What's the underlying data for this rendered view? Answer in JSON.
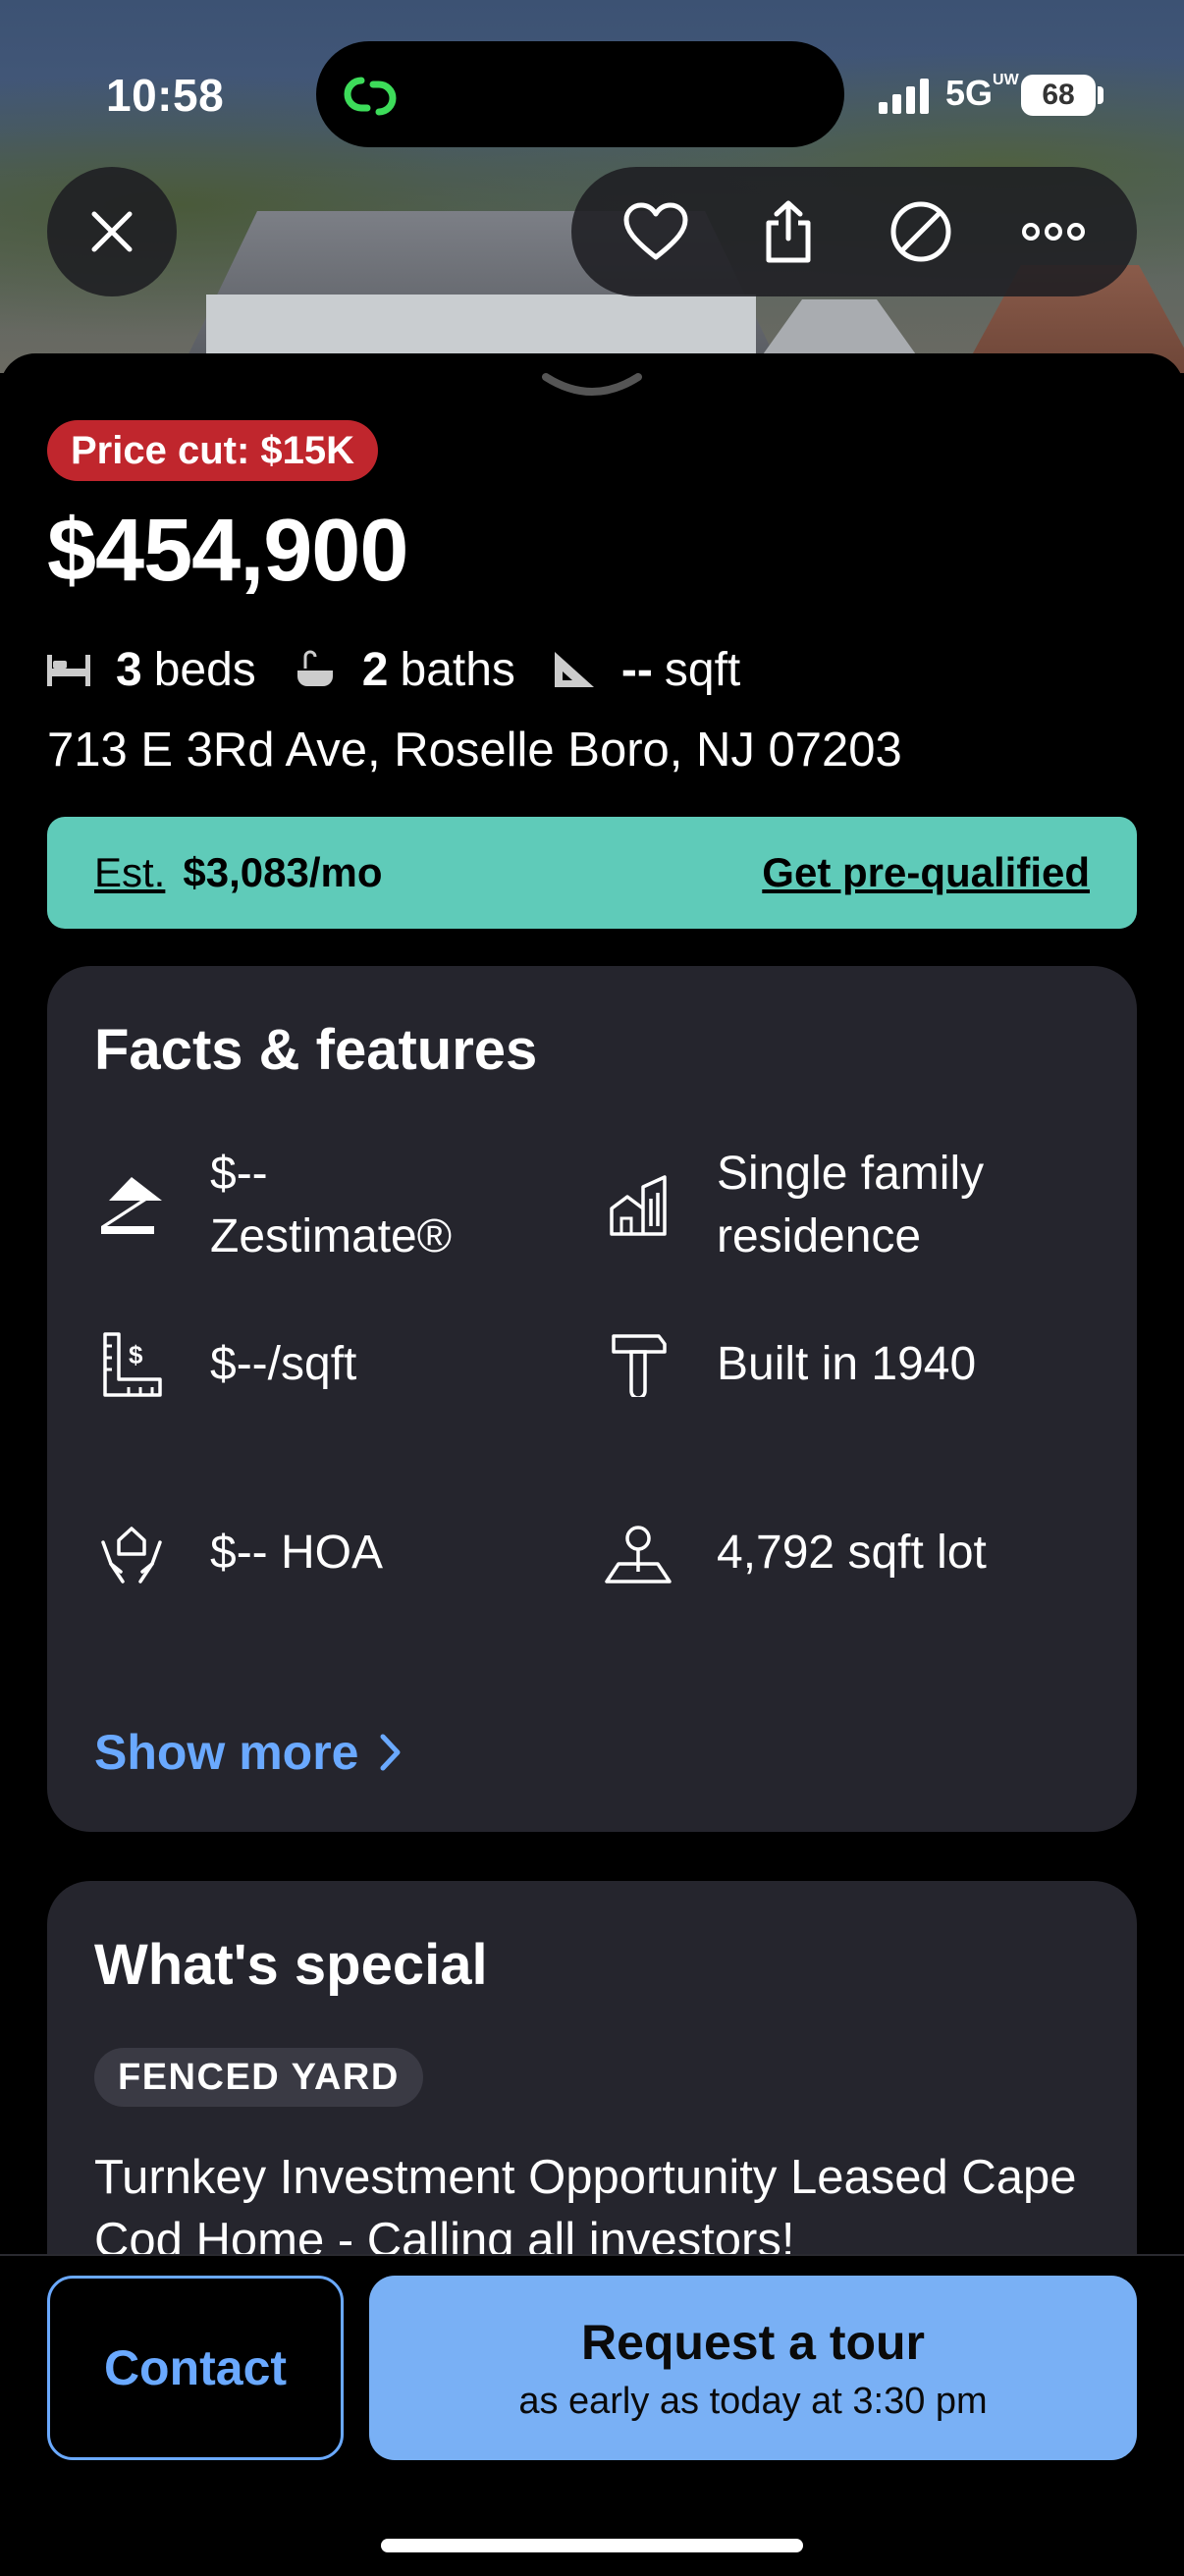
{
  "status_bar": {
    "time": "10:58",
    "network": "5G",
    "network_superscript": "UW",
    "battery": "68"
  },
  "header_actions": {
    "close_icon": "close-icon",
    "icons": [
      "heart-icon",
      "share-icon",
      "hide-icon",
      "more-icon"
    ]
  },
  "listing": {
    "badge": "Price cut: $15K",
    "price": "$454,900",
    "beds_num": "3",
    "beds_label": "beds",
    "baths_num": "2",
    "baths_label": "baths",
    "sqft_num": "--",
    "sqft_label": "sqft",
    "address": "713 E 3Rd Ave, Roselle Boro, NJ 07203"
  },
  "estimate": {
    "label": "Est.",
    "value": "$3,083/mo",
    "cta": "Get pre-qualified",
    "color": "#5fcbb9"
  },
  "facts": {
    "title": "Facts & features",
    "items": [
      {
        "icon": "zillow-icon",
        "text": "$--\nZestimate®"
      },
      {
        "icon": "building-icon",
        "text": "Single family\nresidence"
      },
      {
        "icon": "ruler-dollar-icon",
        "text": "$--/sqft"
      },
      {
        "icon": "hammer-icon",
        "text": "Built in 1940"
      },
      {
        "icon": "hoa-hands-icon",
        "text": "$-- HOA"
      },
      {
        "icon": "lot-icon",
        "text": "4,792 sqft lot"
      }
    ],
    "show_more": "Show more"
  },
  "special": {
    "title": "What's special",
    "tag": "FENCED YARD",
    "description": "Turnkey Investment Opportunity Leased Cape Cod Home - Calling all investors!"
  },
  "bottom": {
    "contact": "Contact",
    "tour_title": "Request a tour",
    "tour_sub": "as early as today at 3:30 pm",
    "accent": "#79b0f5"
  }
}
